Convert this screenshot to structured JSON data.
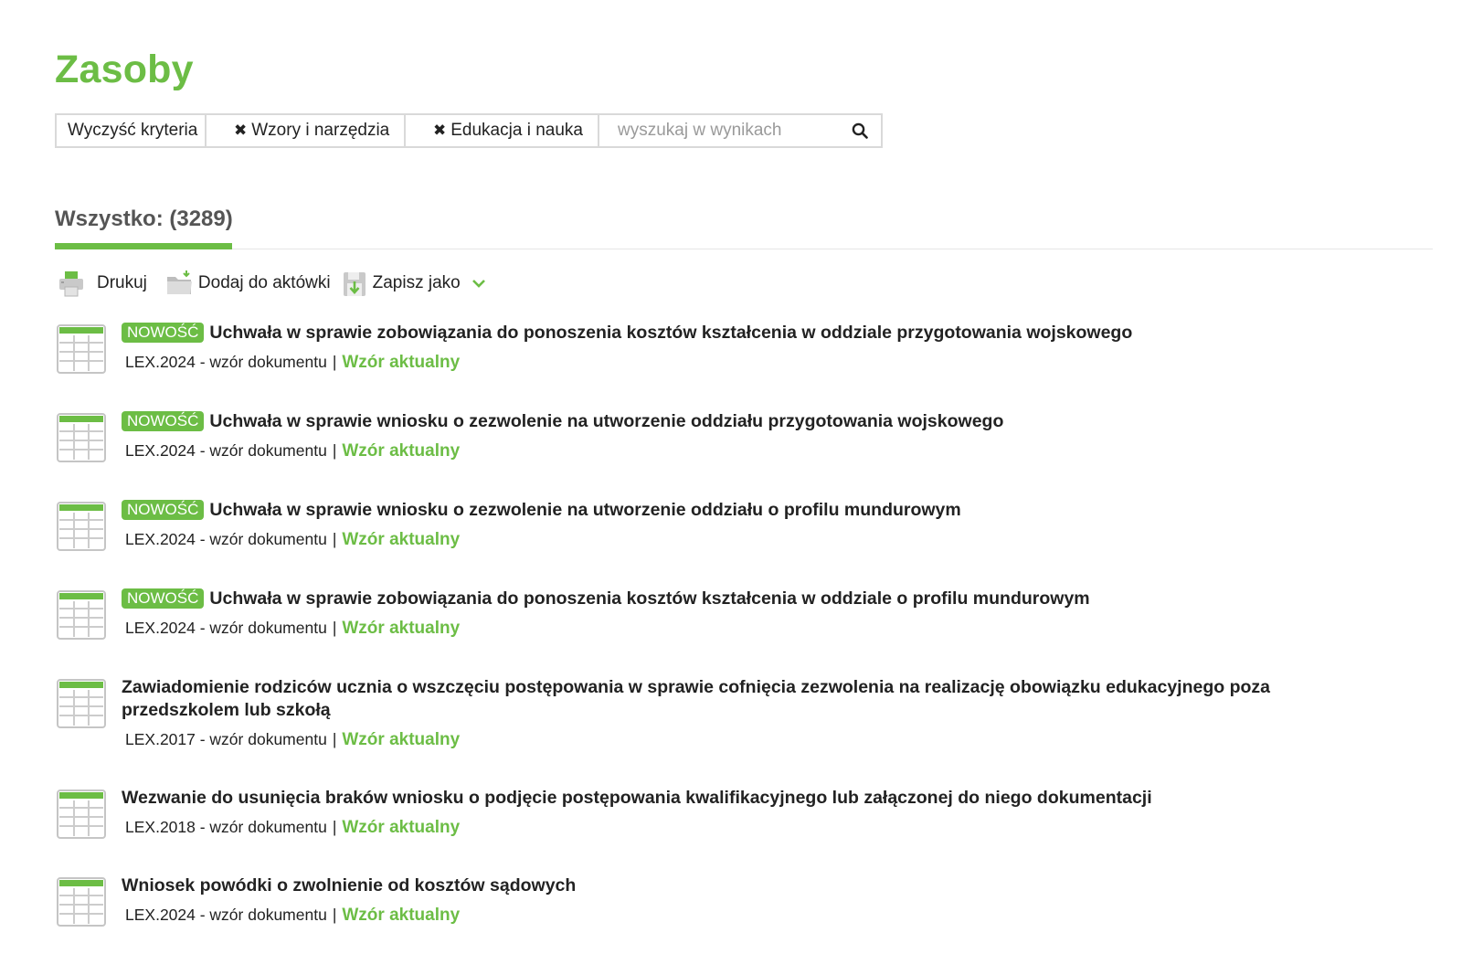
{
  "page": {
    "title": "Zasoby"
  },
  "filters": {
    "clear_label": "Wyczyść kryteria",
    "chips": [
      {
        "label": "Wzory i narzędzia",
        "remove_glyph": "✖"
      },
      {
        "label": "Edukacja i nauka",
        "remove_glyph": "✖"
      }
    ],
    "search_placeholder": "wyszukaj w wynikach",
    "search_icon": "search-icon"
  },
  "tabs": {
    "all_label": "Wszystko: (3289)"
  },
  "toolbar": {
    "print_label": "Drukuj",
    "add_label": "Dodaj do aktówki",
    "save_label": "Zapisz jako"
  },
  "colors": {
    "accent": "#6cbd45",
    "text": "#222222",
    "tab_text": "#555555",
    "border": "#d9d9d9"
  },
  "results": [
    {
      "badge": "NOWOŚĆ",
      "title": "Uchwała w sprawie zobowiązania do ponoszenia kosztów kształcenia w oddziale przygotowania wojskowego",
      "source": "LEX.2024 - wzór dokumentu",
      "separator": "|",
      "status": "Wzór aktualny"
    },
    {
      "badge": "NOWOŚĆ",
      "title": "Uchwała w sprawie wniosku o zezwolenie na utworzenie oddziału przygotowania wojskowego",
      "source": "LEX.2024 - wzór dokumentu",
      "separator": "|",
      "status": "Wzór aktualny"
    },
    {
      "badge": "NOWOŚĆ",
      "title": "Uchwała w sprawie wniosku o zezwolenie na utworzenie oddziału o profilu mundurowym",
      "source": "LEX.2024 - wzór dokumentu",
      "separator": "|",
      "status": "Wzór aktualny"
    },
    {
      "badge": "NOWOŚĆ",
      "title": "Uchwała w sprawie zobowiązania do ponoszenia kosztów kształcenia w oddziale o profilu mundurowym",
      "source": "LEX.2024 - wzór dokumentu",
      "separator": "|",
      "status": "Wzór aktualny"
    },
    {
      "badge": "",
      "title": "Zawiadomienie rodziców ucznia o wszczęciu postępowania w sprawie cofnięcia zezwolenia na realizację obowiązku edukacyjnego poza przedszkolem lub szkołą",
      "source": "LEX.2017 - wzór dokumentu",
      "separator": "|",
      "status": "Wzór aktualny"
    },
    {
      "badge": "",
      "title": "Wezwanie do usunięcia braków wniosku o podjęcie postępowania kwalifikacyjnego lub załączonej do niego dokumentacji",
      "source": "LEX.2018 - wzór dokumentu",
      "separator": "|",
      "status": "Wzór aktualny"
    },
    {
      "badge": "",
      "title": "Wniosek powódki o zwolnienie od kosztów sądowych",
      "source": "LEX.2024 - wzór dokumentu",
      "separator": "|",
      "status": "Wzór aktualny"
    }
  ]
}
